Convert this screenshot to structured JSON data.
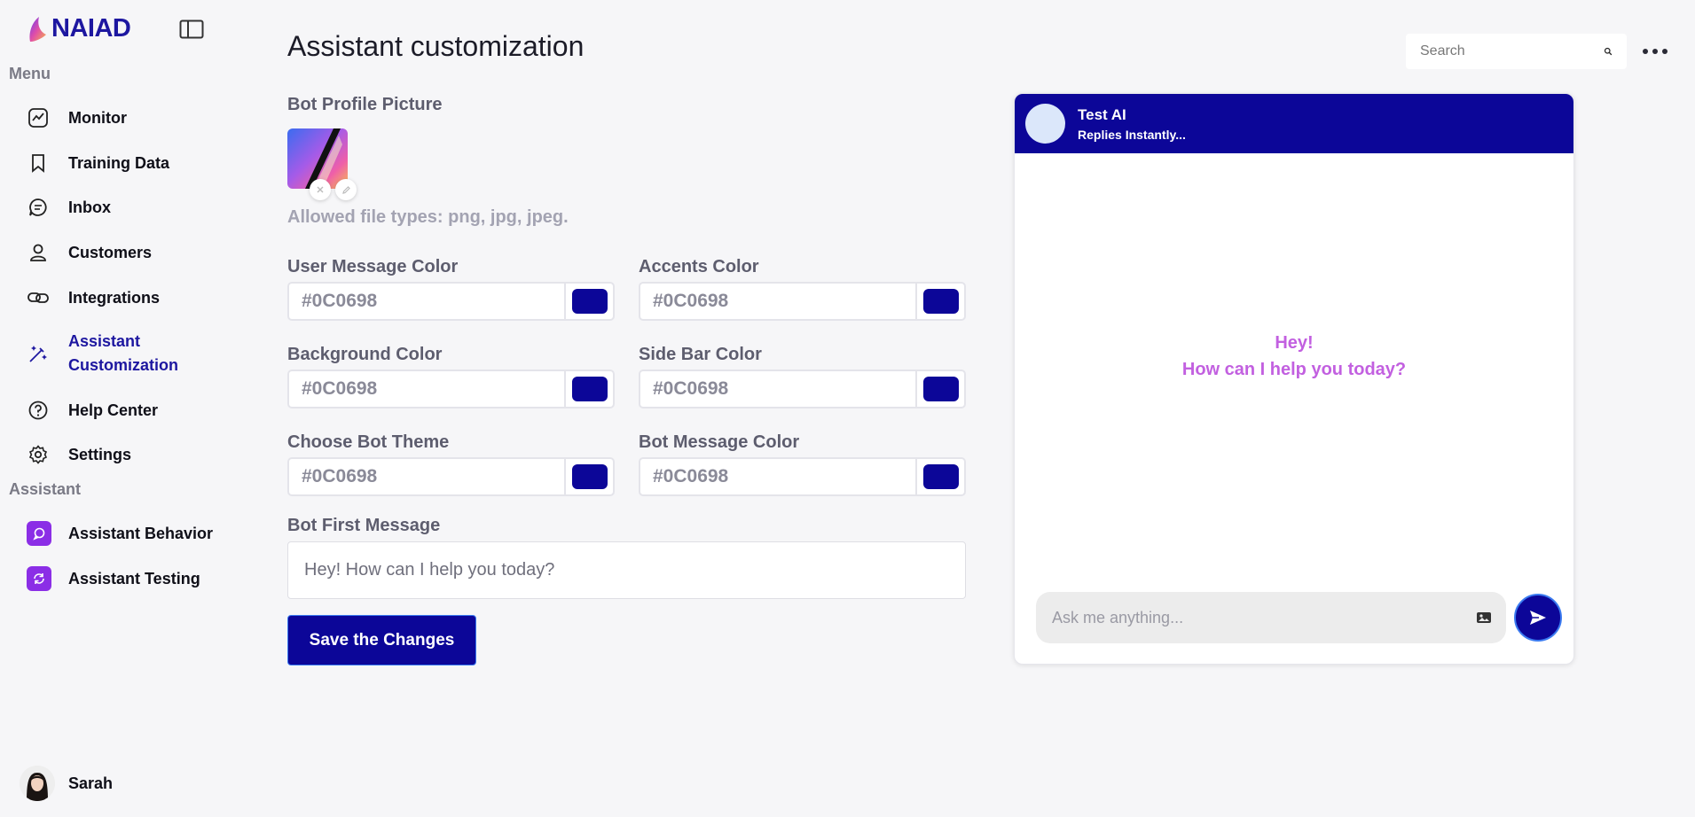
{
  "brand": {
    "name": "NAIAD"
  },
  "sidebar": {
    "menu_label": "Menu",
    "menu_items": [
      {
        "label": "Monitor",
        "icon": "chart-line-icon"
      },
      {
        "label": "Training Data",
        "icon": "bookmark-icon"
      },
      {
        "label": "Inbox",
        "icon": "chat-icon"
      },
      {
        "label": "Customers",
        "icon": "user-icon"
      },
      {
        "label": "Integrations",
        "icon": "link-icon"
      },
      {
        "label_line1": "Assistant",
        "label_line2": "Customization",
        "icon": "magic-wand-icon",
        "active": true
      },
      {
        "label": "Help Center",
        "icon": "help-circle-icon"
      },
      {
        "label": "Settings",
        "icon": "gear-icon"
      }
    ],
    "assistant_label": "Assistant",
    "assistant_items": [
      {
        "label": "Assistant Behavior",
        "icon": "chat-bubble-icon"
      },
      {
        "label": "Assistant Testing",
        "icon": "refresh-icon"
      }
    ],
    "user": {
      "name": "Sarah"
    }
  },
  "header": {
    "title": "Assistant customization",
    "search_placeholder": "Search"
  },
  "form": {
    "profile_picture_label": "Bot Profile Picture",
    "allowed_types": "Allowed file types: png, jpg, jpeg.",
    "fields": [
      {
        "label": "User Message Color",
        "value": "#0C0698",
        "swatch": "#0c0698"
      },
      {
        "label": "Accents Color",
        "value": "#0C0698",
        "swatch": "#0c0698"
      },
      {
        "label": "Background Color",
        "value": "#0C0698",
        "swatch": "#0c0698"
      },
      {
        "label": "Side Bar Color",
        "value": "#0C0698",
        "swatch": "#0c0698"
      },
      {
        "label": "Choose Bot Theme",
        "value": "#0C0698",
        "swatch": "#0c0698"
      },
      {
        "label": "Bot Message Color",
        "value": "#0C0698",
        "swatch": "#0c0698"
      }
    ],
    "first_message_label": "Bot First Message",
    "first_message_value": "Hey! How can I help you today?",
    "save_label": "Save the Changes"
  },
  "preview": {
    "bot_name": "Test AI",
    "bot_status": "Replies Instantly...",
    "welcome_line1": "Hey!",
    "welcome_line2": "How can I help you today?",
    "input_placeholder": "Ask me anything..."
  },
  "colors": {
    "primary": "#0c0698",
    "accent_purple": "#8b2ee6",
    "welcome_text": "#c260e0"
  }
}
